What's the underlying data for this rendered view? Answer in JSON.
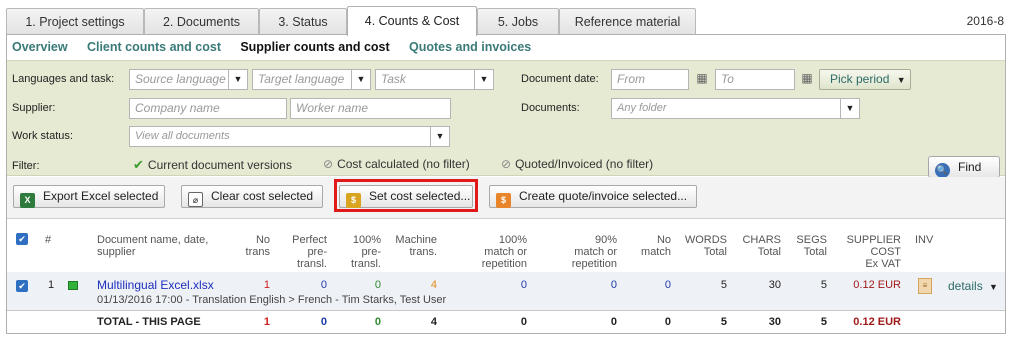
{
  "tabs": [
    {
      "label": "1. Project settings"
    },
    {
      "label": "2. Documents"
    },
    {
      "label": "3. Status"
    },
    {
      "label": "4. Counts & Cost"
    },
    {
      "label": "5. Jobs"
    },
    {
      "label": "Reference material"
    }
  ],
  "year_label": "2016-8",
  "subnav": [
    "Overview",
    "Client counts and cost",
    "Supplier counts and cost",
    "Quotes and invoices"
  ],
  "filters": {
    "lang_label": "Languages and task:",
    "source_placeholder": "Source language",
    "target_placeholder": "Target language",
    "task_placeholder": "Task",
    "supplier_label": "Supplier:",
    "company_placeholder": "Company name",
    "worker_placeholder": "Worker name",
    "work_status_label": "Work status:",
    "work_status_placeholder": "View all documents",
    "filter_label": "Filter:",
    "current_versions": "Current document versions",
    "cost_calculated": "Cost calculated (no filter)",
    "quoted_invoiced": "Quoted/Invoiced (no filter)",
    "doc_date_label": "Document date:",
    "from_placeholder": "From",
    "to_placeholder": "To",
    "pick_period": "Pick period",
    "documents_label": "Documents:",
    "folder_placeholder": "Any folder",
    "find_label": "Find"
  },
  "actions": {
    "export_excel": "Export Excel selected",
    "clear_cost": "Clear cost selected",
    "set_cost": "Set cost selected...",
    "create_quote": "Create quote/invoice selected..."
  },
  "table": {
    "headers": {
      "num": "#",
      "doc": [
        "Document name, date,",
        "supplier"
      ],
      "no_trans": [
        "No",
        "trans"
      ],
      "perfect": [
        "Perfect",
        "pre-",
        "transl."
      ],
      "pct100": [
        "100%",
        "pre-",
        "transl."
      ],
      "machine": [
        "Machine",
        "trans."
      ],
      "match100": [
        "100%",
        "match or",
        "repetition"
      ],
      "match90": [
        "90%",
        "match or",
        "repetition"
      ],
      "no_match": [
        "No",
        "match"
      ],
      "words": [
        "WORDS",
        "Total"
      ],
      "chars": [
        "CHARS",
        "Total"
      ],
      "segs": [
        "SEGS",
        "Total"
      ],
      "supplier_cost": [
        "SUPPLIER",
        "COST",
        "Ex VAT"
      ],
      "inv": "INV"
    },
    "row": {
      "num": "1",
      "name": "Multilingual Excel.xlsx",
      "meta": "01/13/2016 17:00 - Translation English > French - Tim Starks, Test User",
      "no_trans": "1",
      "perfect": "0",
      "pct100": "0",
      "machine": "4",
      "match100": "0",
      "match90": "0",
      "no_match": "0",
      "words": "5",
      "chars": "30",
      "segs": "5",
      "cost": "0.12 EUR",
      "details": "details"
    },
    "total": {
      "label": "TOTAL - THIS PAGE",
      "no_trans": "1",
      "perfect": "0",
      "pct100": "0",
      "machine": "4",
      "match100": "0",
      "match90": "0",
      "no_match": "0",
      "words": "5",
      "chars": "30",
      "segs": "5",
      "cost": "0.12 EUR"
    }
  },
  "colors": {
    "accent_link": "#3a7a78",
    "filter_bg": "#e6ead3",
    "highlight": "#e01919",
    "row_bg": "#eef1f6"
  }
}
